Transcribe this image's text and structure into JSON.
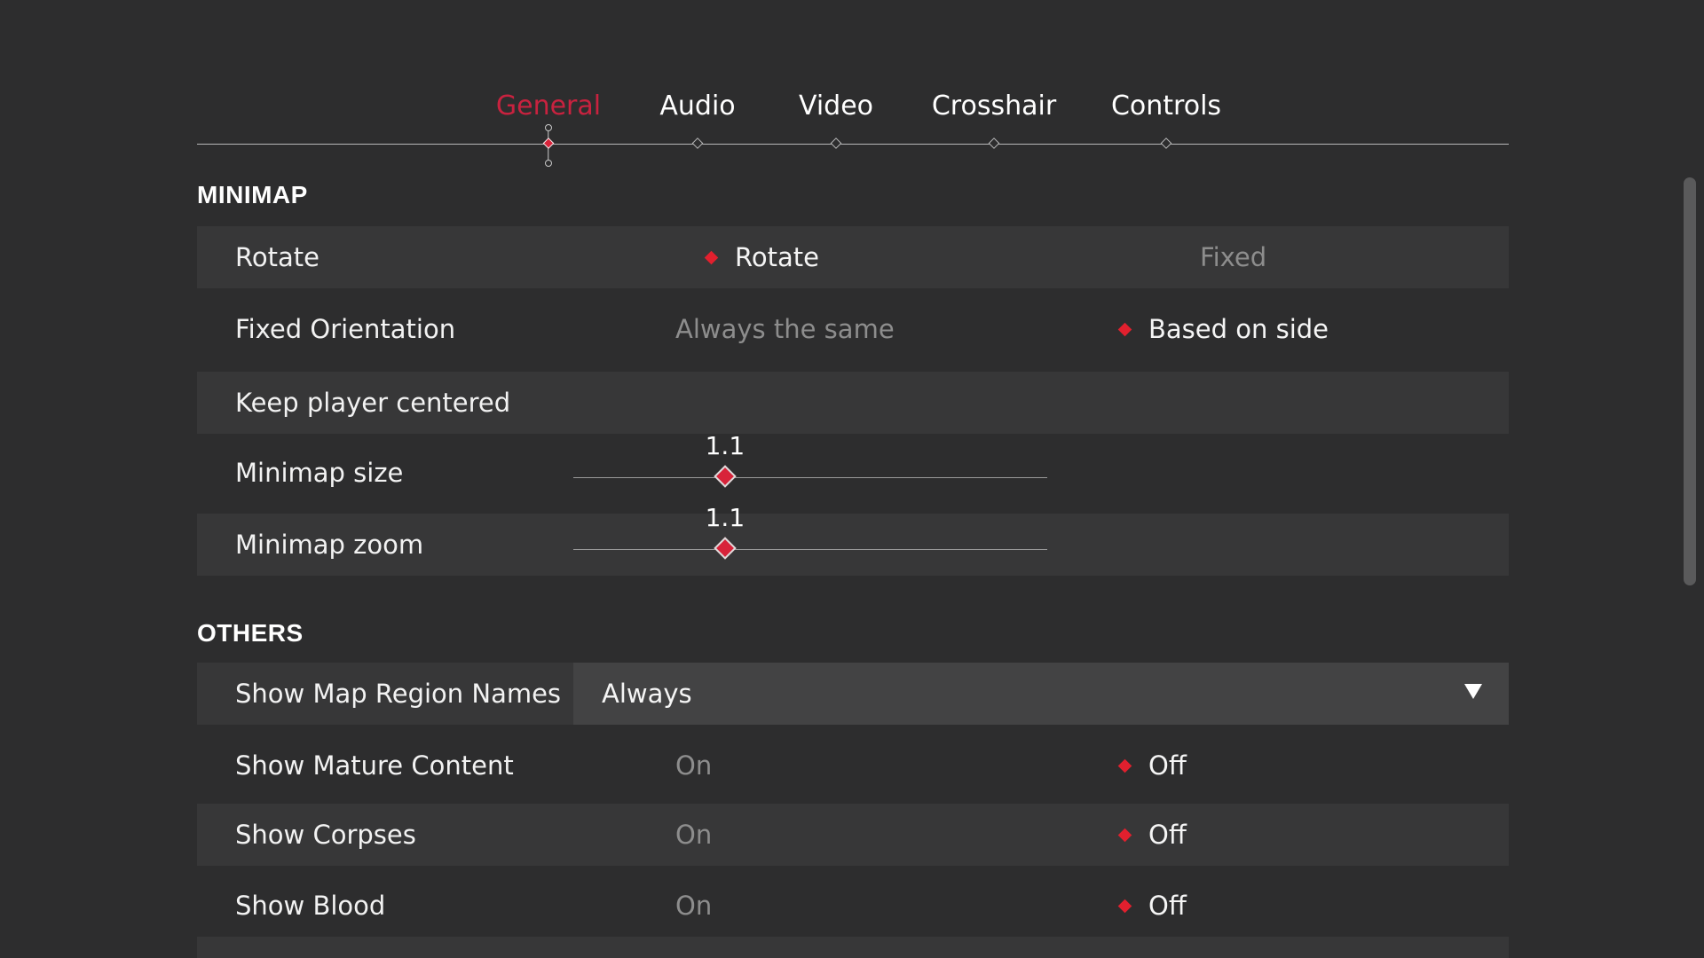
{
  "tabs": [
    {
      "label": "General",
      "active": true
    },
    {
      "label": "Audio",
      "active": false
    },
    {
      "label": "Video",
      "active": false
    },
    {
      "label": "Crosshair",
      "active": false
    },
    {
      "label": "Controls",
      "active": false
    }
  ],
  "minimap": {
    "title": "MINIMAP",
    "rotate": {
      "label": "Rotate",
      "options": [
        "Rotate",
        "Fixed"
      ],
      "selected": "Rotate"
    },
    "fixed_orientation": {
      "label": "Fixed Orientation",
      "options": [
        "Always the same",
        "Based on side"
      ],
      "selected": "Based on side"
    },
    "keep_centered": {
      "label": "Keep player centered"
    },
    "size": {
      "label": "Minimap size",
      "value": "1.1",
      "fraction": 0.32
    },
    "zoom": {
      "label": "Minimap zoom",
      "value": "1.1",
      "fraction": 0.32
    }
  },
  "others": {
    "title": "OTHERS",
    "region_names": {
      "label": "Show Map Region Names",
      "value": "Always"
    },
    "mature": {
      "label": "Show Mature Content",
      "options": [
        "On",
        "Off"
      ],
      "selected": "Off"
    },
    "corpses": {
      "label": "Show Corpses",
      "options": [
        "On",
        "Off"
      ],
      "selected": "Off"
    },
    "blood": {
      "label": "Show Blood",
      "options": [
        "On",
        "Off"
      ],
      "selected": "Off"
    }
  },
  "colors": {
    "background": "#2d2d2e",
    "row_shaded": "#373738",
    "accent": "#e1202e",
    "active_tab": "#c8223f",
    "dimmed_text": "#8d8d8d"
  },
  "icons": {
    "selected_indicator": "red-diamond-icon",
    "dropdown": "triangle-down-icon",
    "tab_marker": "diamond-outline-icon"
  }
}
